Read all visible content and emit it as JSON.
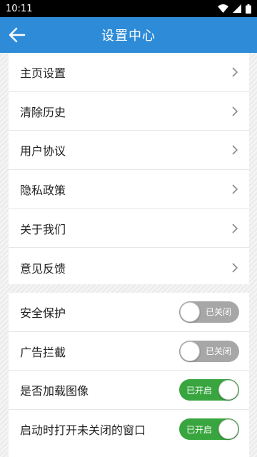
{
  "status_bar": {
    "time": "10:11",
    "icons": [
      "wifi-icon",
      "signal-icon",
      "battery-icon"
    ]
  },
  "header": {
    "title": "设置中心",
    "back_icon": "arrow-left-icon"
  },
  "menu": {
    "items": [
      {
        "label": "主页设置"
      },
      {
        "label": "清除历史"
      },
      {
        "label": "用户协议"
      },
      {
        "label": "隐私政策"
      },
      {
        "label": "关于我们"
      },
      {
        "label": "意见反馈"
      }
    ]
  },
  "settings": {
    "items": [
      {
        "label": "安全保护",
        "state_text": "已关闭",
        "on": false
      },
      {
        "label": "广告拦截",
        "state_text": "已关闭",
        "on": false
      },
      {
        "label": "是否加载图像",
        "state_text": "已开启",
        "on": true
      },
      {
        "label": "启动时打开未关闭的窗口",
        "state_text": "已开启",
        "on": true
      }
    ]
  },
  "colors": {
    "app_bar": "#2e8bd7",
    "toggle_on": "#39a53f",
    "toggle_off": "#a7a7a7"
  }
}
